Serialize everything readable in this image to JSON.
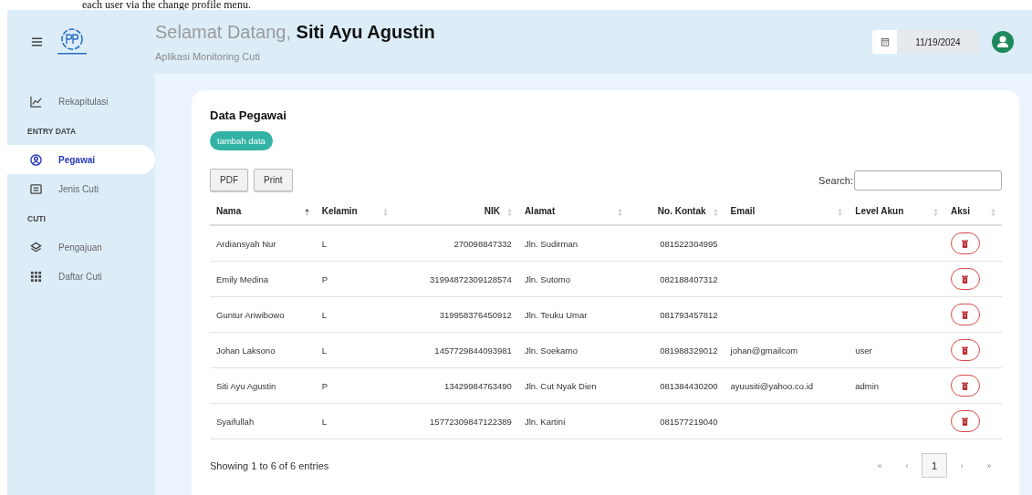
{
  "document_caption": "each user via the change profile menu.",
  "header": {
    "greeting": "Selamat Datang,",
    "user_name": "Siti Ayu Agustin",
    "subtitle": "Aplikasi Monitoring Cuti",
    "date": "11/19/2024"
  },
  "sidebar": {
    "items": [
      {
        "label": "Rekapitulasi",
        "selected": false
      }
    ],
    "sections": [
      {
        "heading": "ENTRY DATA",
        "items": [
          {
            "label": "Pegawai",
            "selected": true
          },
          {
            "label": "Jenis Cuti",
            "selected": false
          }
        ]
      },
      {
        "heading": "CUTI",
        "items": [
          {
            "label": "Pengajuan",
            "selected": false
          },
          {
            "label": "Daftar Cuti",
            "selected": false
          }
        ]
      }
    ]
  },
  "card": {
    "title": "Data Pegawai",
    "add_button": "tambah data",
    "export_buttons": [
      "PDF",
      "Print"
    ],
    "search_label": "Search:",
    "table": {
      "columns": [
        {
          "label": "Nama",
          "sorted": true
        },
        {
          "label": "Kelamin",
          "sorted": false
        },
        {
          "label": "NIK",
          "sorted": false
        },
        {
          "label": "Alamat",
          "sorted": false
        },
        {
          "label": "No. Kontak",
          "sorted": false
        },
        {
          "label": "Email",
          "sorted": false
        },
        {
          "label": "Level Akun",
          "sorted": false
        },
        {
          "label": "Aksi",
          "sorted": false
        }
      ],
      "rows": [
        [
          "Ardiansyah Nur",
          "L",
          "270098847332",
          "Jln. Sudirman",
          "081522304995",
          "",
          ""
        ],
        [
          "Emily Medina",
          "P",
          "31994872309128574",
          "Jln. Sutomo",
          "082188407312",
          "",
          ""
        ],
        [
          "Guntur Ariwibowo",
          "L",
          "319958376450912",
          "Jln. Teuku Umar",
          "081793457812",
          "",
          ""
        ],
        [
          "Johan Laksono",
          "L",
          "1457729844093981",
          "Jln. Soekarno",
          "081988329012",
          "johan@gmailcom",
          "user"
        ],
        [
          "Siti Ayu Agustin",
          "P",
          "13429984763490",
          "Jln. Cut Nyak Dien",
          "081384430200",
          "ayuusiti@yahoo.co.id",
          "admin"
        ],
        [
          "Syaifullah",
          "L",
          "15772309847122389",
          "Jln. Kartini",
          "081577219040",
          "",
          ""
        ]
      ]
    },
    "info": "Showing 1 to 6 of 6 entries",
    "pagination": [
      {
        "label": "«",
        "selected": false
      },
      {
        "label": "‹",
        "selected": false
      },
      {
        "label": "1",
        "selected": true
      },
      {
        "label": "›",
        "selected": false
      },
      {
        "label": "»",
        "selected": false
      }
    ]
  }
}
